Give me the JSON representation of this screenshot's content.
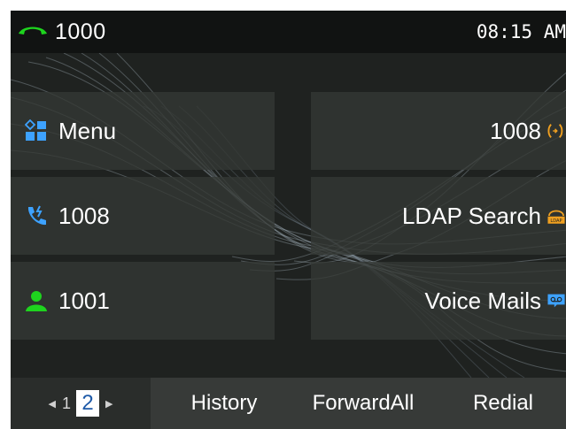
{
  "status": {
    "line_number": "1000",
    "time": "08:15 AM"
  },
  "keys": {
    "menu": {
      "label": "Menu"
    },
    "right_1": {
      "label": "1008"
    },
    "speed_dial": {
      "label": "1008"
    },
    "ldap": {
      "label": "LDAP Search",
      "icon_text": "LDAP"
    },
    "contact": {
      "label": "1001"
    },
    "voicemail": {
      "label": "Voice Mails"
    }
  },
  "pager": {
    "pages": [
      "1",
      "2"
    ],
    "current": "2"
  },
  "softkeys": [
    "History",
    "ForwardAll",
    "Redial"
  ],
  "colors": {
    "green": "#1ed41e",
    "blue": "#3da2ff",
    "orange": "#f0a020"
  },
  "icons": {
    "line_status": "handset-green-icon",
    "menu": "menu-grid-icon",
    "right_1": "intercom-icon",
    "speed_dial": "speed-dial-phone-icon",
    "ldap": "ldap-headset-icon",
    "contact": "contact-person-icon",
    "voicemail": "voicemail-icon"
  }
}
